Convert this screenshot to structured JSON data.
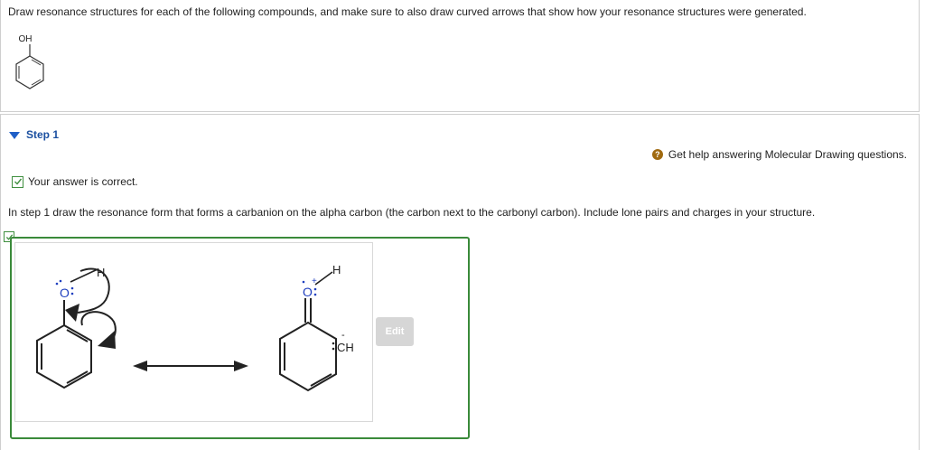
{
  "question": {
    "text": "Draw resonance structures for each of the following compounds, and make sure to also draw curved arrows that show how your resonance structures were generated.",
    "structure_label": "OH"
  },
  "step": {
    "title": "Step 1",
    "help_text": "Get help answering Molecular Drawing questions.",
    "correct_text": "Your answer is correct.",
    "instruction": "In step 1 draw the resonance form that forms a carbanion on the alpha carbon (the carbon next to the carbonyl carbon). Include lone pairs and charges in your structure.",
    "edit_label": "Edit"
  },
  "drawing": {
    "left_o": "O",
    "left_h": "H",
    "right_o": "O",
    "right_plus": "+",
    "right_h": "H",
    "right_ch": "CH",
    "right_minus": "-"
  },
  "colors": {
    "link": "#1a4fa0",
    "correct_green": "#3a8a3a",
    "atom_blue": "#1f3fbf",
    "help_icon": "#a06a10"
  }
}
